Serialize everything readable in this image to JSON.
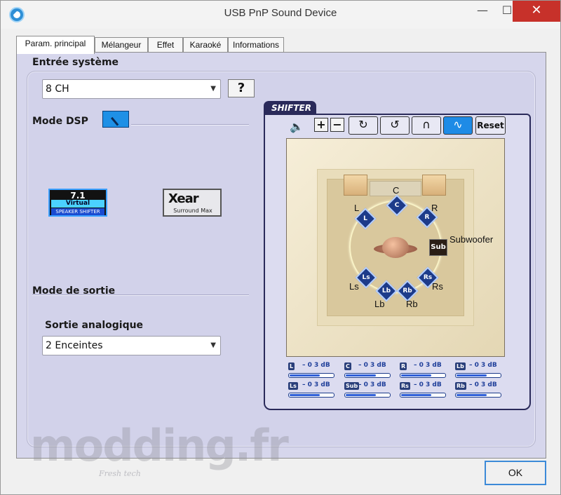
{
  "window": {
    "title": "USB PnP Sound Device",
    "min": "—",
    "max": "☐",
    "close": "✕"
  },
  "tabs": [
    "Param. principal",
    "Mélangeur",
    "Effet",
    "Karaoké",
    "Informations"
  ],
  "main": {
    "system_input_label": "Entrée système",
    "system_input_value": "8 CH",
    "help": "?",
    "dsp_mode_label": "Mode DSP",
    "logo71": {
      "num": "7.1",
      "line1": "Virtual",
      "line2": "SPEAKER SHIFTER"
    },
    "xear": {
      "big": "Xear",
      "small": "Surround Max"
    },
    "output_mode_label": "Mode de sortie",
    "analog_output_label": "Sortie analogique",
    "analog_output_value": "2 Enceintes"
  },
  "shifter": {
    "tab": "SHIFTER",
    "reset": "Reset",
    "speakers": {
      "C": "C",
      "L": "L",
      "R": "R",
      "Ls": "Ls",
      "Rs": "Rs",
      "Lb": "Lb",
      "Rb": "Rb",
      "Sub": "Sub"
    },
    "labels": {
      "C": "C",
      "L": "L",
      "R": "R",
      "Ls": "Ls",
      "Rs": "Rs",
      "Lb": "Lb",
      "Rb": "Rb",
      "Subwoofer": "Subwoofer"
    },
    "meters": [
      {
        "tag": "L",
        "db": "– 0 3 dB",
        "level": 0.7
      },
      {
        "tag": "C",
        "db": "– 0 3 dB",
        "level": 0.7
      },
      {
        "tag": "R",
        "db": "– 0 3 dB",
        "level": 0.7
      },
      {
        "tag": "Lb",
        "db": "– 0 3 dB",
        "level": 0.7
      },
      {
        "tag": "Ls",
        "db": "– 0 3 dB",
        "level": 0.7
      },
      {
        "tag": "Sub",
        "db": "– 0 3 dB",
        "level": 0.7
      },
      {
        "tag": "Rs",
        "db": "– 0 3 dB",
        "level": 0.7
      },
      {
        "tag": "Rb",
        "db": "– 0 3 dB",
        "level": 0.7
      }
    ]
  },
  "watermark": {
    "big": "modding.fr",
    "small": "Fresh tech"
  },
  "ok": "OK"
}
